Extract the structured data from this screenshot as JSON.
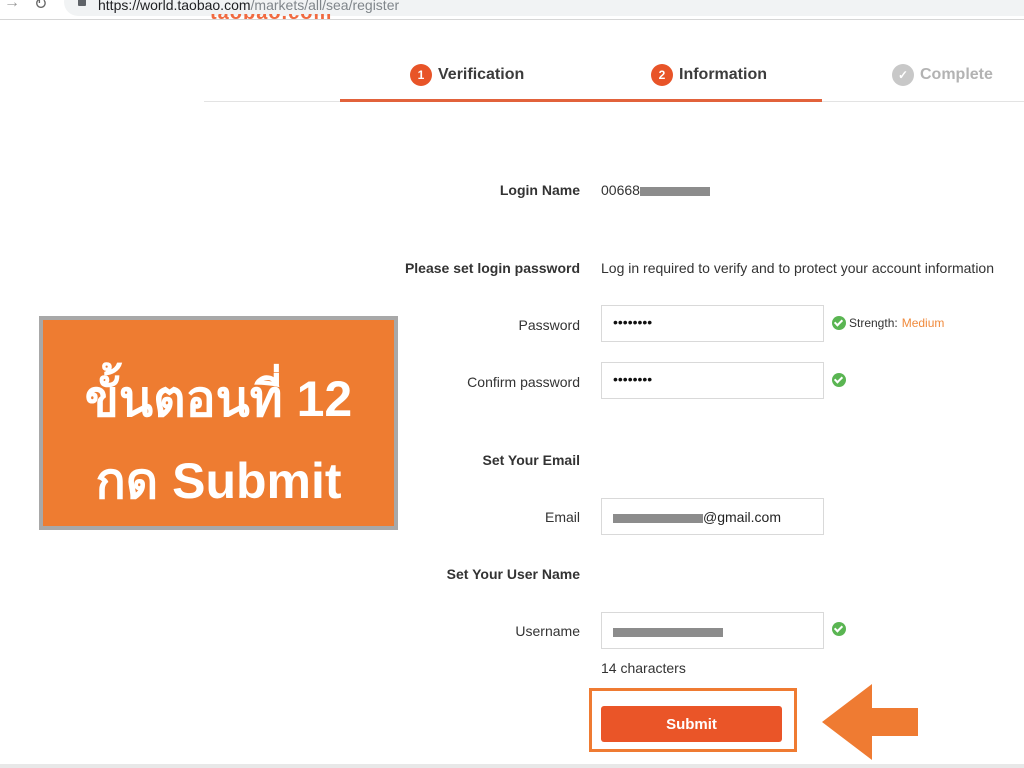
{
  "browser": {
    "url_host": "https://world.taobao.com",
    "url_path": "/markets/all/sea/register",
    "logo_text": "taobao.com"
  },
  "steps": [
    {
      "number": "1",
      "label": "Verification",
      "state": "completed"
    },
    {
      "number": "2",
      "label": "Information",
      "state": "active"
    },
    {
      "number": "✓",
      "label": "Complete",
      "state": "pending"
    }
  ],
  "form": {
    "login_name_label": "Login Name",
    "login_name_value": "00668",
    "password_section_label": "Please set login password",
    "password_section_desc": "Log in required to verify and to protect your account information",
    "password_label": "Password",
    "password_value": "••••••••",
    "strength_label": "Strength:",
    "strength_value": "Medium",
    "confirm_label": "Confirm password",
    "confirm_value": "••••••••",
    "email_section_label": "Set Your Email",
    "email_label": "Email",
    "email_value": "@gmail.com",
    "username_section_label": "Set Your User Name",
    "username_label": "Username",
    "username_hint": "14 characters",
    "submit_label": "Submit"
  },
  "callout": {
    "line1": "ขั้นตอนที่ 12",
    "line2": "กด Submit"
  },
  "colors": {
    "accent": "#ea5528",
    "callout": "#ee7c31",
    "success": "#5ab552",
    "strength": "#f08a3c"
  }
}
